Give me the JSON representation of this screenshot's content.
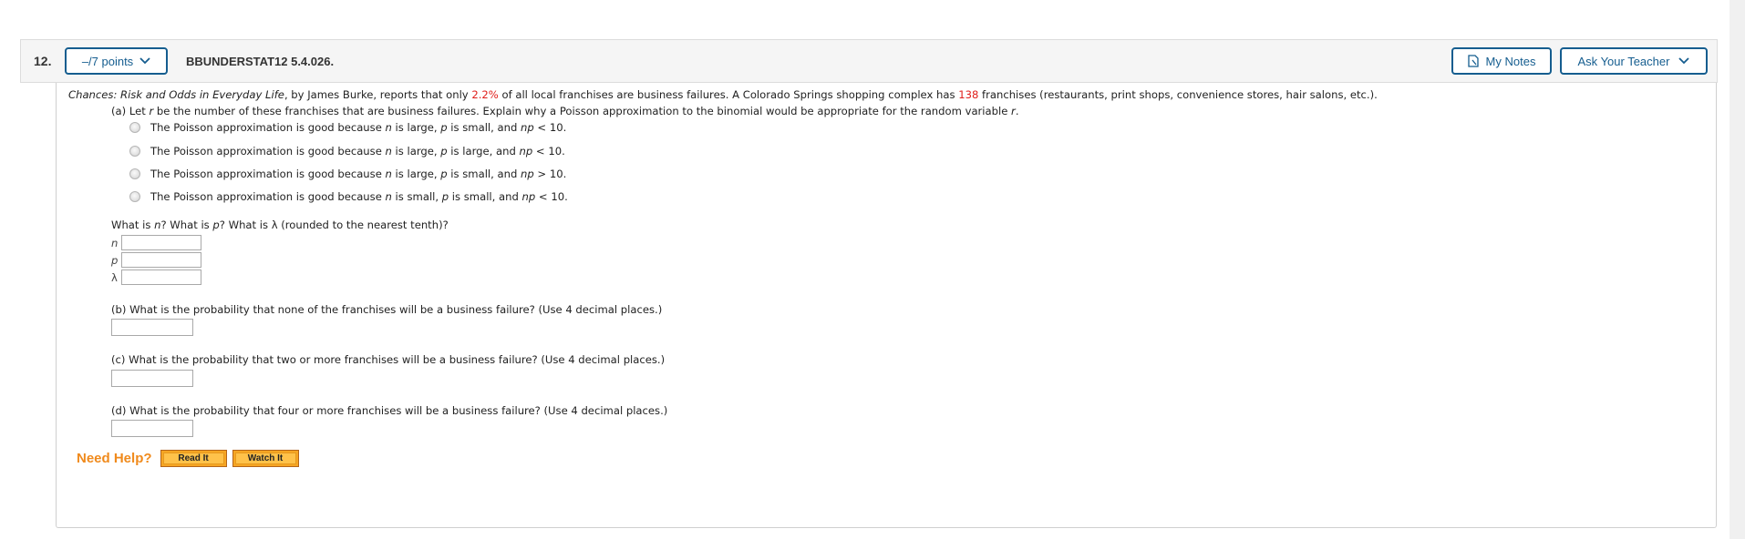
{
  "question": {
    "number": "12.",
    "points_label": "–/7 points",
    "code": "BBUNDERSTAT12 5.4.026.",
    "my_notes_label": "My Notes",
    "ask_teacher_label": "Ask Your Teacher"
  },
  "intro": {
    "book_title": "Chances: Risk and Odds in Everyday Life",
    "text_1": ", by James Burke, reports that only ",
    "percent": "2.2%",
    "text_2": " of all local franchises are business failures. A Colorado Springs shopping complex has ",
    "count": "138",
    "text_3": " franchises (restaurants, print shops, convenience stores, hair salons, etc.)."
  },
  "part_a": {
    "prefix": "(a) Let ",
    "var": "r",
    "middle": " be the number of these franchises that are business failures. Explain why a Poisson approximation to the binomial would be appropriate for the random variable ",
    "suffix": ".",
    "options": [
      {
        "a": "The Poisson approximation is good because ",
        "n": "n",
        "b": " is large, ",
        "p": "p",
        "c": " is small, and ",
        "np": "np",
        "d": " < 10."
      },
      {
        "a": "The Poisson approximation is good because ",
        "n": "n",
        "b": " is large, ",
        "p": "p",
        "c": " is large, and ",
        "np": "np",
        "d": " < 10."
      },
      {
        "a": "The Poisson approximation is good because ",
        "n": "n",
        "b": " is large, ",
        "p": "p",
        "c": " is small, and ",
        "np": "np",
        "d": " > 10."
      },
      {
        "a": "The Poisson approximation is good because ",
        "n": "n",
        "b": " is small, ",
        "p": "p",
        "c": " is small, and ",
        "np": "np",
        "d": " < 10."
      }
    ]
  },
  "params": {
    "q1": "What is ",
    "n": "n",
    "q2": "? What is ",
    "p": "p",
    "q3": "? What is λ (rounded to the nearest tenth)?",
    "labels": [
      "n",
      "p",
      "λ"
    ],
    "values": [
      "",
      "",
      ""
    ]
  },
  "part_b": {
    "question": "(b) What is the probability that none of the franchises will be a business failure? (Use 4 decimal places.)",
    "value": ""
  },
  "part_c": {
    "question": "(c) What is the probability that two or more franchises will be a business failure? (Use 4 decimal places.)",
    "value": ""
  },
  "part_d": {
    "question": "(d) What is the probability that four or more franchises will be a business failure? (Use 4 decimal places.)",
    "value": ""
  },
  "help": {
    "label": "Need Help?",
    "read_it": "Read It",
    "watch_it": "Watch It"
  },
  "colors": {
    "accent": "#155d8f",
    "highlight": "#e0201c",
    "help_orange": "#f08a1c"
  }
}
